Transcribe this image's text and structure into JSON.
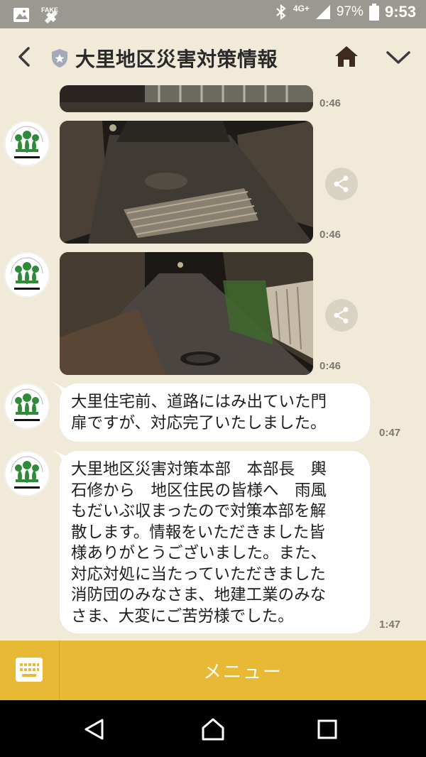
{
  "status_bar": {
    "network": "4G+",
    "battery": "97%",
    "time": "9:53",
    "icons": [
      "image-icon",
      "fake-gps-icon",
      "bluetooth-icon",
      "signal-icon",
      "battery-icon"
    ]
  },
  "header": {
    "title": "大里地区災害対策情報",
    "icons": [
      "back-arrow-icon",
      "official-shield-icon",
      "home-icon",
      "chevron-down-icon"
    ]
  },
  "messages": [
    {
      "type": "image",
      "time": "0:46",
      "scene": "partial night street photo"
    },
    {
      "type": "image",
      "time": "0:46",
      "scene": "night street with fallen gate grating",
      "share": true
    },
    {
      "type": "image",
      "time": "0:46",
      "scene": "night street with displaced gate",
      "share": true
    },
    {
      "type": "text",
      "time": "0:47",
      "lines": [
        "大里住宅前、道路にはみ出ていた門",
        "扉ですが、対応完了いたしました。"
      ]
    },
    {
      "type": "text",
      "time": "1:47",
      "lines": [
        "大里地区災害対策本部　本部長　輿",
        "石修から　地区住民の皆様へ　雨風",
        "もだいぶ収まったので対策本部を解",
        "散します。情報をいただきました皆",
        "様ありがとうございました。また、",
        "対応対処に当たっていただきました",
        "消防団のみなさま、地建工業のみな",
        "さま、大変にご苦労様でした。"
      ]
    }
  ],
  "avatar_caption": "大里地区災害対策本部",
  "menu_bar": {
    "label": "メニュー"
  },
  "colors": {
    "background": "#f1ead8",
    "menu": "#e8b935",
    "status": "#9b9891",
    "bubble": "#ffffff"
  }
}
